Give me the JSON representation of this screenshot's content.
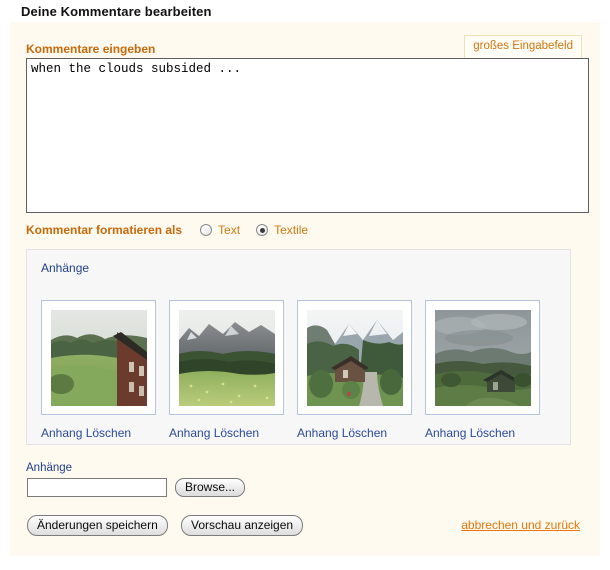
{
  "page": {
    "title": "Deine Kommentare bearbeiten"
  },
  "comment_section": {
    "label": "Kommentare eingeben",
    "large_input_link": "großes Eingabefeld",
    "textarea_value": "when the clouds subsided ...",
    "textarea_placeholder": ""
  },
  "format_section": {
    "label": "Kommentar formatieren als",
    "options": [
      {
        "label": "Text",
        "selected": false
      },
      {
        "label": "Textile",
        "selected": true
      }
    ]
  },
  "attachments_panel": {
    "title": "Anhänge",
    "items": [
      {
        "delete_label": "Anhang Löschen",
        "alt": "meadow-with-wooden-house-thumbnail"
      },
      {
        "delete_label": "Anhang Löschen",
        "alt": "mountain-ridge-over-green-field-thumbnail"
      },
      {
        "delete_label": "Anhang Löschen",
        "alt": "alpine-valley-path-with-chalet-thumbnail"
      },
      {
        "delete_label": "Anhang Löschen",
        "alt": "overcast-valley-with-farmhouse-thumbnail"
      }
    ]
  },
  "upload_section": {
    "label": "Anhänge",
    "file_value": "",
    "file_placeholder": "",
    "browse_label": "Browse..."
  },
  "actions": {
    "save_label": "Änderungen speichern",
    "preview_label": "Vorschau anzeigen",
    "cancel_label": "abbrechen und zurück"
  },
  "colors": {
    "panel_background": "#fffaef",
    "accent_orange": "#c8690b",
    "link_orange": "#e8760c",
    "link_blue": "#2b4a9b",
    "attachments_background": "#f7f7f7"
  }
}
